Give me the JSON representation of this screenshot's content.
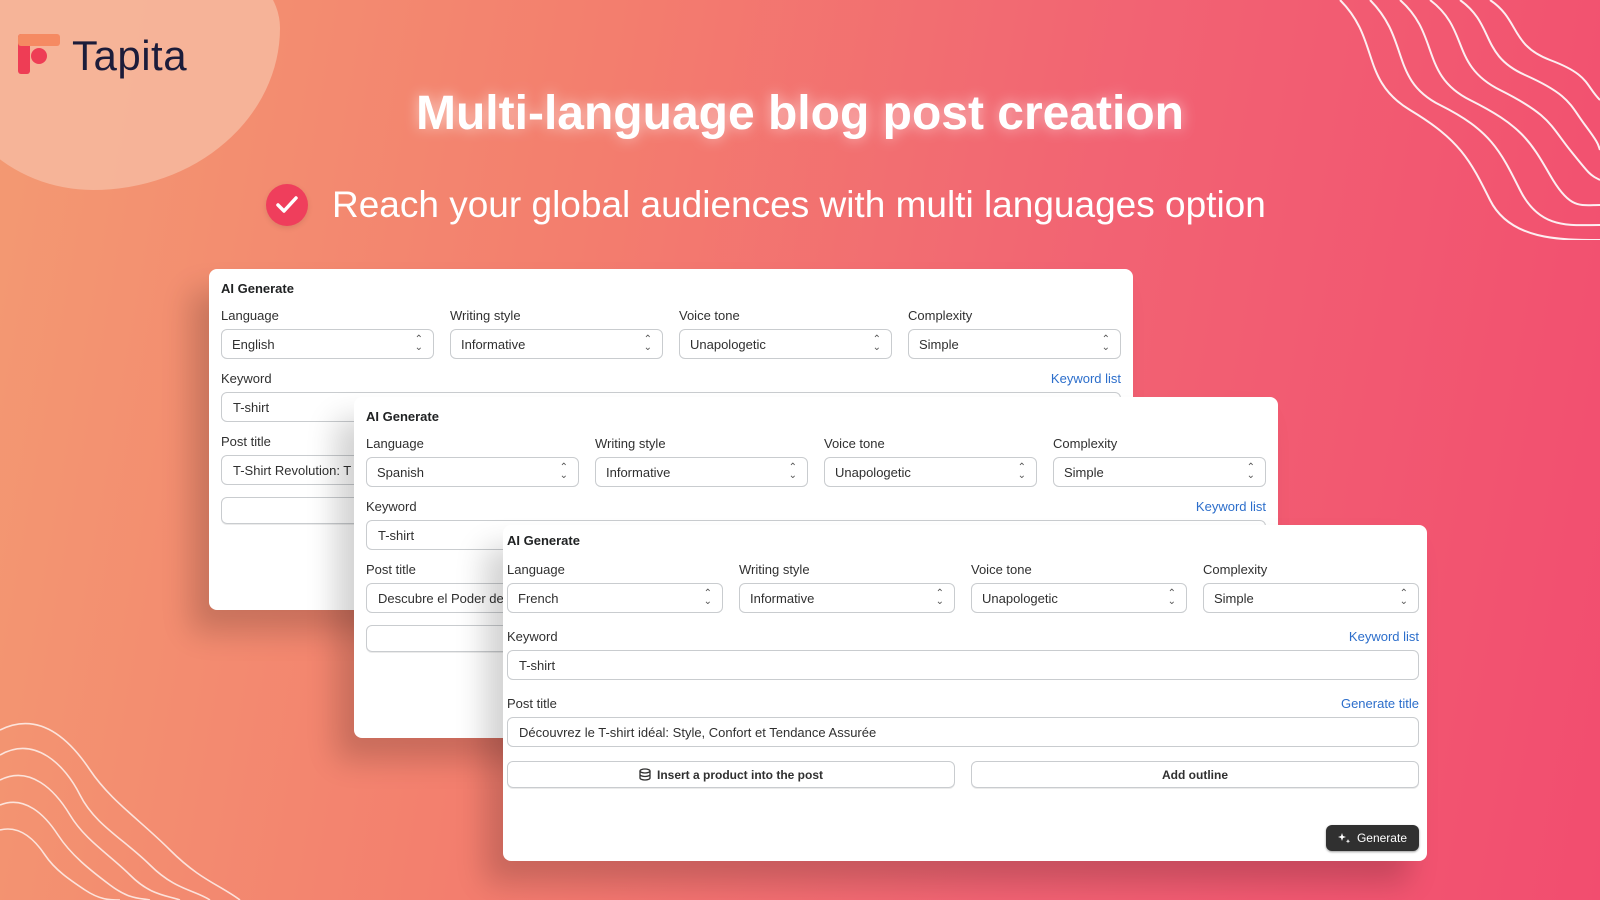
{
  "brand": {
    "name": "Tapita",
    "mark_colors": [
      "#ee3d55",
      "#f58a62"
    ]
  },
  "headline": "Multi-language blog post creation",
  "subheadline": "Reach your global audiences with multi languages option",
  "field_labels": {
    "language": "Language",
    "writing_style": "Writing style",
    "voice_tone": "Voice tone",
    "complexity": "Complexity",
    "keyword": "Keyword",
    "keyword_list": "Keyword list",
    "post_title": "Post title",
    "generate_title": "Generate title"
  },
  "cards": [
    {
      "title": "AI Generate",
      "language": "English",
      "writing_style": "Informative",
      "voice_tone": "Unapologetic",
      "complexity": "Simple",
      "keyword": "T-shirt",
      "post_title": "T-Shirt Revolution: T"
    },
    {
      "title": "AI Generate",
      "language": "Spanish",
      "writing_style": "Informative",
      "voice_tone": "Unapologetic",
      "complexity": "Simple",
      "keyword": "T-shirt",
      "post_title": "Descubre el Poder de"
    },
    {
      "title": "AI Generate",
      "language": "French",
      "writing_style": "Informative",
      "voice_tone": "Unapologetic",
      "complexity": "Simple",
      "keyword": "T-shirt",
      "post_title": "Découvrez le T-shirt idéal: Style, Confort et Tendance Assurée"
    }
  ],
  "buttons": {
    "insert_product": "Insert a product into the post",
    "add_outline": "Add outline",
    "generate": "Generate"
  },
  "icons": {
    "check": "checkmark-icon",
    "database": "database-icon",
    "sparkle": "sparkle-icon",
    "select": "chevron-updown-icon"
  },
  "colors": {
    "accent_link": "#2c6ecb",
    "check_bg": "#ef3e5c",
    "primary_button": "#303030"
  }
}
